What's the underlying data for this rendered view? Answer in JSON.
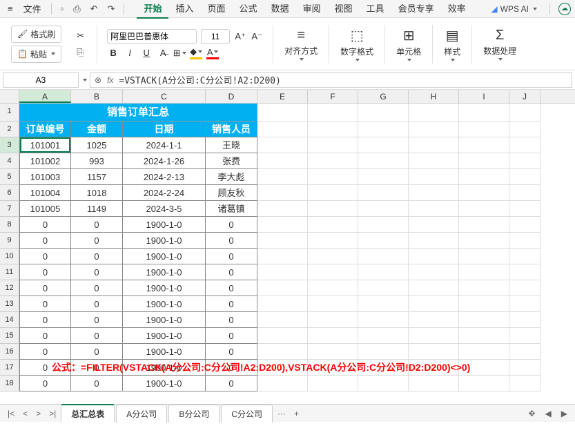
{
  "menubar": {
    "file": "文件",
    "tabs": [
      "开始",
      "插入",
      "页面",
      "公式",
      "数据",
      "审阅",
      "视图",
      "工具",
      "会员专享",
      "效率"
    ],
    "active_tab": 0,
    "wps_ai": "WPS AI"
  },
  "ribbon": {
    "format_painter": "格式刷",
    "paste": "粘贴",
    "font_name": "阿里巴巴普惠体",
    "font_size": "11",
    "align": "对齐方式",
    "number_format": "数字格式",
    "cell_format": "单元格",
    "styles": "样式",
    "data_process": "数据处理"
  },
  "formula_bar": {
    "cell_ref": "A3",
    "formula": "=VSTACK(A分公司:C分公司!A2:D200)"
  },
  "columns": [
    "A",
    "B",
    "C",
    "D",
    "E",
    "F",
    "G",
    "H",
    "I",
    "J"
  ],
  "title_row": "销售订单汇总",
  "headers": [
    "订单编号",
    "金额",
    "日期",
    "销售人员"
  ],
  "data_rows": [
    {
      "r": 3,
      "a": "101001",
      "b": "1025",
      "c": "2024-1-1",
      "d": "王晓"
    },
    {
      "r": 4,
      "a": "101002",
      "b": "993",
      "c": "2024-1-26",
      "d": "张费"
    },
    {
      "r": 5,
      "a": "101003",
      "b": "1157",
      "c": "2024-2-13",
      "d": "李大彪"
    },
    {
      "r": 6,
      "a": "101004",
      "b": "1018",
      "c": "2024-2-24",
      "d": "顾友秋"
    },
    {
      "r": 7,
      "a": "101005",
      "b": "1149",
      "c": "2024-3-5",
      "d": "诸葛镇"
    },
    {
      "r": 8,
      "a": "0",
      "b": "0",
      "c": "1900-1-0",
      "d": "0"
    },
    {
      "r": 9,
      "a": "0",
      "b": "0",
      "c": "1900-1-0",
      "d": "0"
    },
    {
      "r": 10,
      "a": "0",
      "b": "0",
      "c": "1900-1-0",
      "d": "0"
    },
    {
      "r": 11,
      "a": "0",
      "b": "0",
      "c": "1900-1-0",
      "d": "0"
    },
    {
      "r": 12,
      "a": "0",
      "b": "0",
      "c": "1900-1-0",
      "d": "0"
    },
    {
      "r": 13,
      "a": "0",
      "b": "0",
      "c": "1900-1-0",
      "d": "0"
    },
    {
      "r": 14,
      "a": "0",
      "b": "0",
      "c": "1900-1-0",
      "d": "0"
    },
    {
      "r": 15,
      "a": "0",
      "b": "0",
      "c": "1900-1-0",
      "d": "0"
    },
    {
      "r": 16,
      "a": "0",
      "b": "0",
      "c": "1900-1-0",
      "d": "0"
    },
    {
      "r": 17,
      "a": "0",
      "b": "0",
      "c": "1900-1-0",
      "d": "0"
    },
    {
      "r": 18,
      "a": "0",
      "b": "0",
      "c": "1900-1-0",
      "d": "0"
    }
  ],
  "overlay_formula": "公式：=FILTER(VSTACK(A分公司:C分公司!A2:D200),VSTACK(A分公司:C分公司!D2:D200)<>0)",
  "sheets": {
    "active": "总汇总表",
    "others": [
      "A分公司",
      "B分公司",
      "C分公司"
    ]
  }
}
